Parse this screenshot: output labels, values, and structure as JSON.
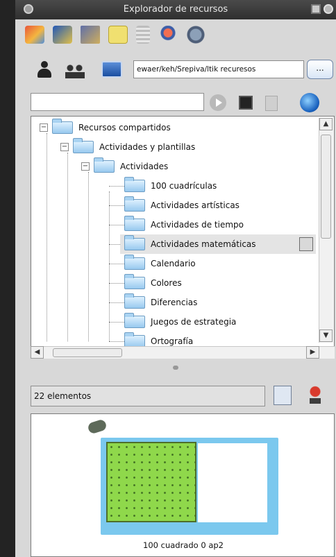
{
  "window": {
    "title": "Explorador de recursos"
  },
  "toolbar": {
    "icons": [
      "paint-icon",
      "brush-icon",
      "scene-icon",
      "note-icon",
      "doc-icon",
      "joystick-icon",
      "gears-icon"
    ]
  },
  "path": {
    "value": "ewaer/keh/Srepiva/ltik recuresos",
    "browse_label": "..."
  },
  "search": {
    "value": ""
  },
  "tree": {
    "items": [
      {
        "label": "Recursos compartidos",
        "level": 0
      },
      {
        "label": "Actividades y plantillas",
        "level": 1
      },
      {
        "label": "Actividades",
        "level": 2
      },
      {
        "label": "100 cuadrículas",
        "level": 3
      },
      {
        "label": "Actividades artísticas",
        "level": 3
      },
      {
        "label": "Actividades de tiempo",
        "level": 3
      },
      {
        "label": "Actividades matemáticas",
        "level": 3,
        "selected": true
      },
      {
        "label": "Calendario",
        "level": 3
      },
      {
        "label": "Colores",
        "level": 3
      },
      {
        "label": "Diferencias",
        "level": 3
      },
      {
        "label": "Juegos de estrategia",
        "level": 3
      },
      {
        "label": "Ortografía",
        "level": 3
      }
    ]
  },
  "panel": {
    "count_label": "22 elementos"
  },
  "preview": {
    "item_label": "100 cuadrado 0 ap2"
  }
}
